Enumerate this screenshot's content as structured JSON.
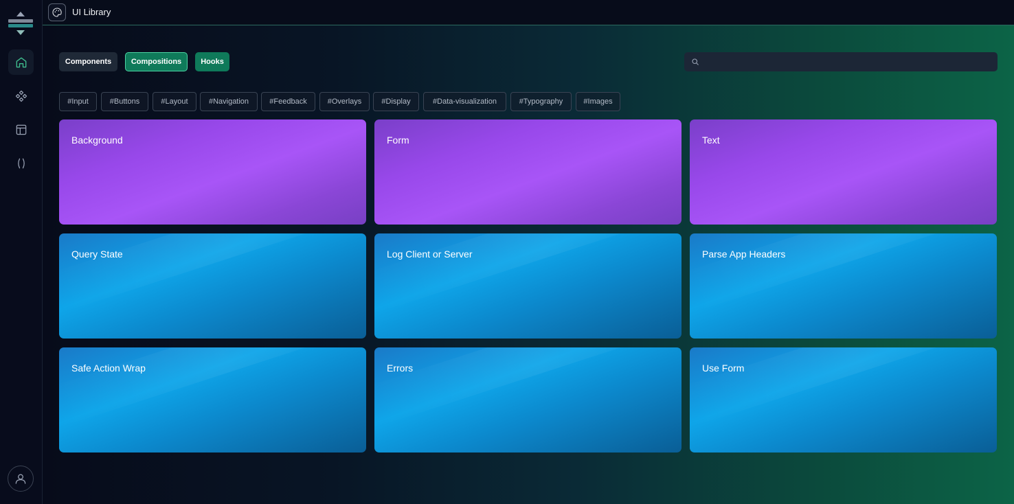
{
  "topbar": {
    "title": "UI Library"
  },
  "tabs": [
    {
      "label": "Components"
    },
    {
      "label": "Compositions"
    },
    {
      "label": "Hooks"
    }
  ],
  "search": {
    "placeholder": ""
  },
  "tags": [
    "#Input",
    "#Buttons",
    "#Layout",
    "#Navigation",
    "#Feedback",
    "#Overlays",
    "#Display",
    "#Data-visualization",
    "#Typography",
    "#Images"
  ],
  "cards": [
    {
      "title": "Background"
    },
    {
      "title": "Form"
    },
    {
      "title": "Text"
    },
    {
      "title": "Query State"
    },
    {
      "title": "Log Client or Server"
    },
    {
      "title": "Parse App Headers"
    },
    {
      "title": "Safe Action Wrap"
    },
    {
      "title": "Errors"
    },
    {
      "title": "Use Form"
    }
  ],
  "colors": {
    "accent_green": "#0f7a5a",
    "card_purple": "#a855f7",
    "card_blue": "#0ea5e9"
  }
}
